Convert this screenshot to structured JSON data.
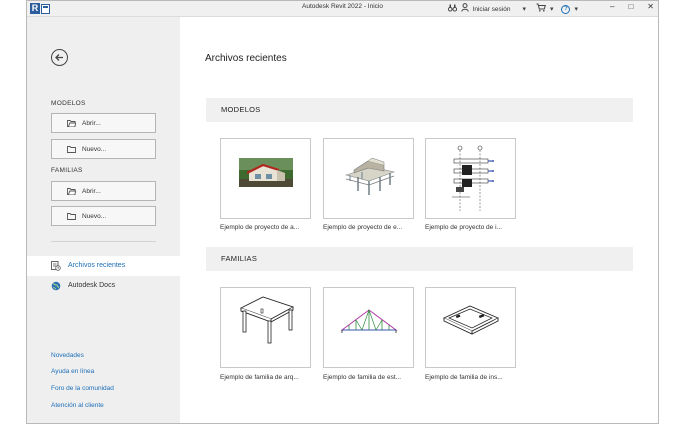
{
  "titlebar": {
    "title": "Autodesk Revit 2022 - Inicio",
    "signin_label": "Iniciar sesión",
    "minimize_glyph": "–",
    "maximize_glyph": "□",
    "close_glyph": "✕",
    "binoculars_icon": "binoculars-icon",
    "user_icon": "user-icon",
    "cart_icon": "cart-icon",
    "help_icon": "help-icon",
    "help_glyph": "?",
    "dropdown_glyph": "▾"
  },
  "sidebar": {
    "models_label": "MODELOS",
    "models_open": "Abrir...",
    "models_new": "Nuevo...",
    "families_label": "FAMILIAS",
    "families_open": "Abrir...",
    "families_new": "Nuevo...",
    "nav": [
      {
        "label": "Archivos recientes",
        "icon": "recent-files-icon",
        "active": true
      },
      {
        "label": "Autodesk Docs",
        "icon": "globe-icon",
        "active": false
      }
    ],
    "links": [
      "Novedades",
      "Ayuda en línea",
      "Foro de la comunidad",
      "Atención al cliente"
    ]
  },
  "main": {
    "title": "Archivos recientes",
    "models_header": "MODELOS",
    "families_header": "FAMILIAS",
    "models": [
      {
        "label": "Ejemplo de proyecto de a..."
      },
      {
        "label": "Ejemplo de proyecto de e..."
      },
      {
        "label": "Ejemplo de proyecto de i..."
      }
    ],
    "families": [
      {
        "label": "Ejemplo de familia de arq..."
      },
      {
        "label": "Ejemplo de familia de est..."
      },
      {
        "label": "Ejemplo de familia de ins..."
      }
    ]
  },
  "colors": {
    "accent": "#1d6fb8",
    "sidebar_bg": "#efefef",
    "header_bg": "#f0f0f0",
    "brand": "#2c5d9c"
  }
}
